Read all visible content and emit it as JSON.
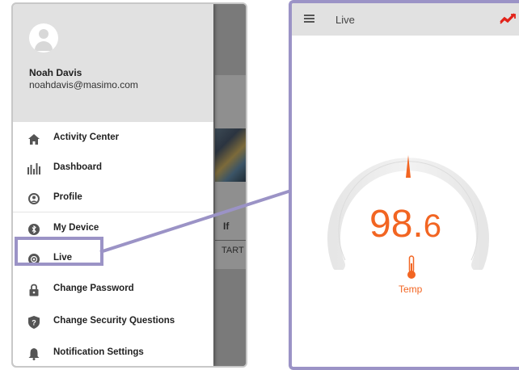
{
  "drawer": {
    "user_name": "Noah Davis",
    "user_email": "noahdavis@masimo.com",
    "items": [
      {
        "label": "Activity Center",
        "icon": "home-icon"
      },
      {
        "label": "Dashboard",
        "icon": "dashboard-icon"
      },
      {
        "label": "Profile",
        "icon": "profile-icon"
      },
      {
        "label": "My Device",
        "icon": "bluetooth-icon"
      },
      {
        "label": "Live",
        "icon": "live-icon"
      },
      {
        "label": "Change Password",
        "icon": "lock-icon"
      },
      {
        "label": "Change Security Questions",
        "icon": "shield-question-icon"
      },
      {
        "label": "Notification Settings",
        "icon": "bell-icon"
      }
    ]
  },
  "background": {
    "fragment_a": "If",
    "fragment_b": "TART"
  },
  "live_screen": {
    "title": "Live",
    "temp_int": "98.",
    "temp_dec": "6",
    "temp_label": "Temp"
  },
  "colors": {
    "accent": "#f26522",
    "highlight": "#9b93c6",
    "header_gray": "#e1e1e1"
  }
}
